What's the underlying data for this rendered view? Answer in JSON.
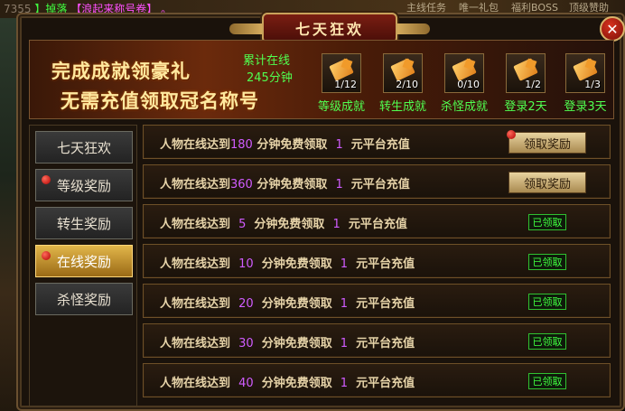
{
  "background": {
    "chat_prefix": "7355",
    "chat_green": "】掉落",
    "chat_magenta": "【浪起来称号卷】",
    "chat_suffix": "。",
    "tabs": [
      "主线任务",
      "唯一礼包",
      "福利BOSS",
      "顶级赞助"
    ]
  },
  "window": {
    "title": "七天狂欢",
    "close_glyph": "✕"
  },
  "banner": {
    "line1": "完成成就领豪礼",
    "line2": "无需充值领取冠名称号",
    "online_label": "累计在线",
    "online_value": "245分钟"
  },
  "achievements": [
    {
      "count": "1/12",
      "label": "等级成就"
    },
    {
      "count": "2/10",
      "label": "转生成就"
    },
    {
      "count": "0/10",
      "label": "杀怪成就"
    },
    {
      "count": "1/2",
      "label": "登录2天"
    },
    {
      "count": "1/3",
      "label": "登录3天"
    }
  ],
  "nav": [
    {
      "label": "七天狂欢",
      "active": false,
      "dot": false
    },
    {
      "label": "等级奖励",
      "active": false,
      "dot": true
    },
    {
      "label": "转生奖励",
      "active": false,
      "dot": false
    },
    {
      "label": "在线奖励",
      "active": true,
      "dot": true
    },
    {
      "label": "杀怪奖励",
      "active": false,
      "dot": false
    }
  ],
  "rows": [
    {
      "prefix": "人物在线达到",
      "minutes": "180",
      "mid": "分钟免费领取",
      "amount": "1",
      "suffix": "元平台充值",
      "status": "领取奖励",
      "claimable": true,
      "dot": true
    },
    {
      "prefix": "人物在线达到",
      "minutes": "360",
      "mid": "分钟免费领取",
      "amount": "1",
      "suffix": "元平台充值",
      "status": "领取奖励",
      "claimable": true,
      "dot": false
    },
    {
      "prefix": "人物在线达到",
      "minutes": "5",
      "mid": "分钟免费领取",
      "amount": "1",
      "suffix": "元平台充值",
      "status": "已领取",
      "claimable": false,
      "dot": false
    },
    {
      "prefix": "人物在线达到",
      "minutes": "10",
      "mid": "分钟免费领取",
      "amount": "1",
      "suffix": "元平台充值",
      "status": "已领取",
      "claimable": false,
      "dot": false
    },
    {
      "prefix": "人物在线达到",
      "minutes": "20",
      "mid": "分钟免费领取",
      "amount": "1",
      "suffix": "元平台充值",
      "status": "已领取",
      "claimable": false,
      "dot": false
    },
    {
      "prefix": "人物在线达到",
      "minutes": "30",
      "mid": "分钟免费领取",
      "amount": "1",
      "suffix": "元平台充值",
      "status": "已领取",
      "claimable": false,
      "dot": false
    },
    {
      "prefix": "人物在线达到",
      "minutes": "40",
      "mid": "分钟免费领取",
      "amount": "1",
      "suffix": "元平台充值",
      "status": "已领取",
      "claimable": false,
      "dot": false
    }
  ]
}
